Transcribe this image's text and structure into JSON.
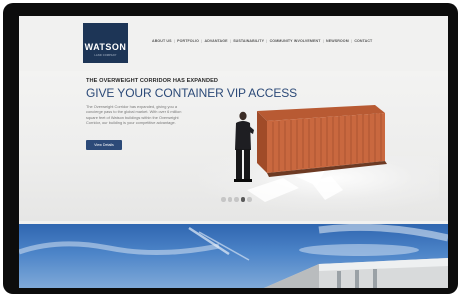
{
  "brand": {
    "name": "WATSON",
    "tagline": "LAND COMPANY",
    "colors": {
      "navy": "#1d3556",
      "accent_blue": "#2c4a78",
      "container": "#c9683f"
    }
  },
  "nav": {
    "items": [
      "ABOUT US",
      "PORTFOLIO",
      "ADVANTAGE",
      "SUSTAINABILITY",
      "COMMUNITY INVOLVEMENT",
      "NEWSROOM",
      "CONTACT"
    ]
  },
  "hero": {
    "kicker": "THE OVERWEIGHT CORRIDOR HAS EXPANDED",
    "headline": "GIVE YOUR CONTAINER VIP ACCESS",
    "body": "The Overweight Corridor has expanded, giving you a concierge pass to the global market. With over 6 million square feet of Watson buildings within the Overweight Corridor, our building is your competitive advantage.",
    "cta_label": "View Details"
  },
  "slider": {
    "count": 5,
    "active_index": 3
  },
  "icons": [
    "logo",
    "slider-dot",
    "container-image",
    "person-image",
    "arrow-shape"
  ]
}
